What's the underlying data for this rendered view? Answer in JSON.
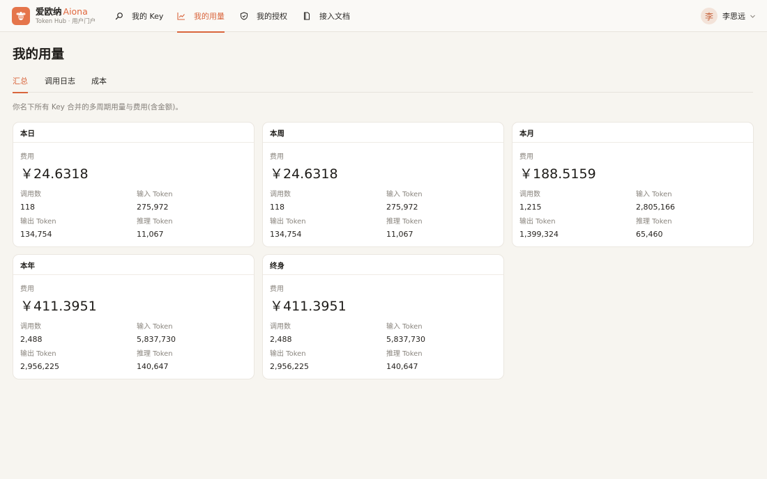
{
  "brand": {
    "name": "爱欧纳",
    "name_en": "Aiona",
    "subtitle": "Token Hub · 用户门户"
  },
  "nav": [
    {
      "label": "我的 Key",
      "icon": "search-icon",
      "active": false
    },
    {
      "label": "我的用量",
      "icon": "chart-line-icon",
      "active": true
    },
    {
      "label": "我的授权",
      "icon": "shield-check-icon",
      "active": false
    },
    {
      "label": "接入文档",
      "icon": "document-icon",
      "active": false
    }
  ],
  "user": {
    "avatar_char": "李",
    "name": "李思远"
  },
  "page": {
    "title": "我的用量",
    "description": "你名下所有 Key 合并的多周期用量与费用(含金额)。"
  },
  "tabs": [
    {
      "label": "汇总",
      "active": true
    },
    {
      "label": "调用日志",
      "active": false
    },
    {
      "label": "成本",
      "active": false
    }
  ],
  "labels": {
    "fee": "费用",
    "calls": "调用数",
    "input_token": "输入 Token",
    "output_token": "输出 Token",
    "reasoning_token": "推理 Token"
  },
  "cards": [
    {
      "title": "本日",
      "fee": "￥24.6318",
      "calls": "118",
      "input": "275,972",
      "output": "134,754",
      "reasoning": "11,067"
    },
    {
      "title": "本周",
      "fee": "￥24.6318",
      "calls": "118",
      "input": "275,972",
      "output": "134,754",
      "reasoning": "11,067"
    },
    {
      "title": "本月",
      "fee": "￥188.5159",
      "calls": "1,215",
      "input": "2,805,166",
      "output": "1,399,324",
      "reasoning": "65,460"
    },
    {
      "title": "本年",
      "fee": "￥411.3951",
      "calls": "2,488",
      "input": "5,837,730",
      "output": "2,956,225",
      "reasoning": "140,647"
    },
    {
      "title": "终身",
      "fee": "￥411.3951",
      "calls": "2,488",
      "input": "5,837,730",
      "output": "2,956,225",
      "reasoning": "140,647"
    }
  ],
  "colors": {
    "accent": "#d9653c",
    "logo": "#e5754b",
    "background": "#f7f5f0"
  }
}
